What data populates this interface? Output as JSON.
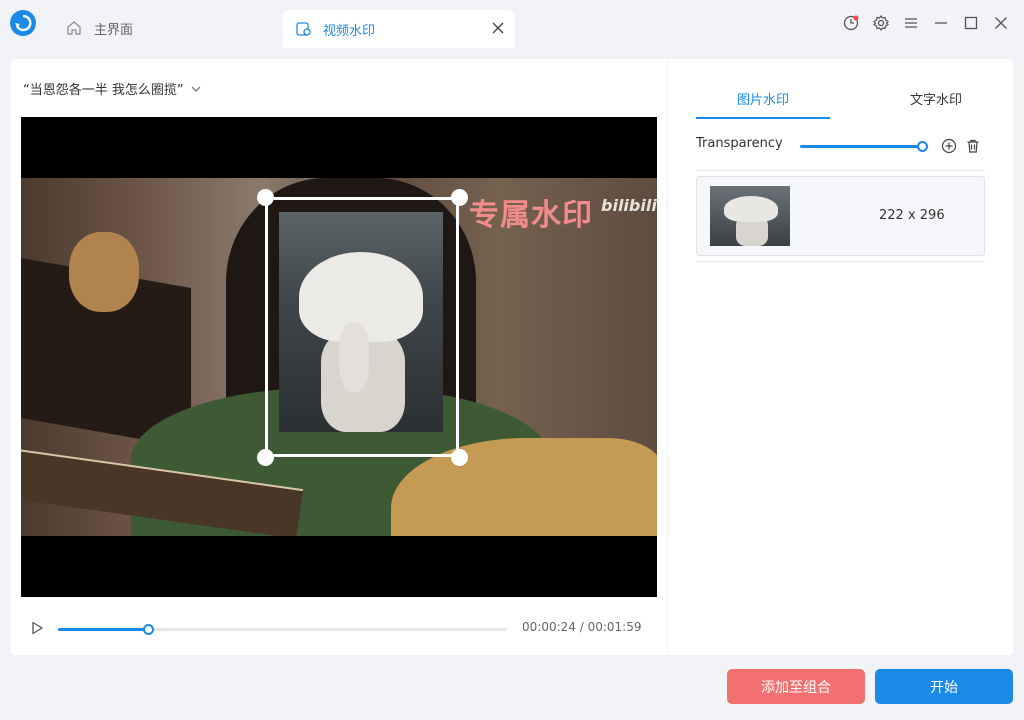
{
  "tabs": {
    "home_label": "主界面",
    "active_label": "视频水印"
  },
  "editor": {
    "file_title": "“当恩怨各一半 我怎么圈揽”",
    "watermark_text": "专属水印",
    "watermark_small": "bilibili",
    "time_current": "00:00:24",
    "time_total": "00:01:59",
    "time_display": "00:00:24 / 00:01:59",
    "progress_fraction": 0.2
  },
  "panel": {
    "tab_image": "图片水印",
    "tab_text": "文字水印",
    "transparency_label": "Transparency",
    "transparency_fraction": 1.0,
    "items": [
      {
        "size": "222 x 296"
      }
    ]
  },
  "buttons": {
    "add_to_combo": "添加至组合",
    "start": "开始"
  },
  "colors": {
    "accent": "#1a8ae6",
    "danger": "#f37070",
    "watermark": "#f28b8b"
  },
  "icons": {
    "logo": "app-logo-icon",
    "home": "home-icon",
    "tab": "video-watermark-icon",
    "close": "close-icon",
    "history": "history-icon",
    "settings": "gear-icon",
    "menu": "menu-icon",
    "minimize": "minimize-icon",
    "maximize": "maximize-icon",
    "window_close": "window-close-icon",
    "play": "play-icon",
    "add": "add-circle-icon",
    "delete": "trash-icon"
  }
}
